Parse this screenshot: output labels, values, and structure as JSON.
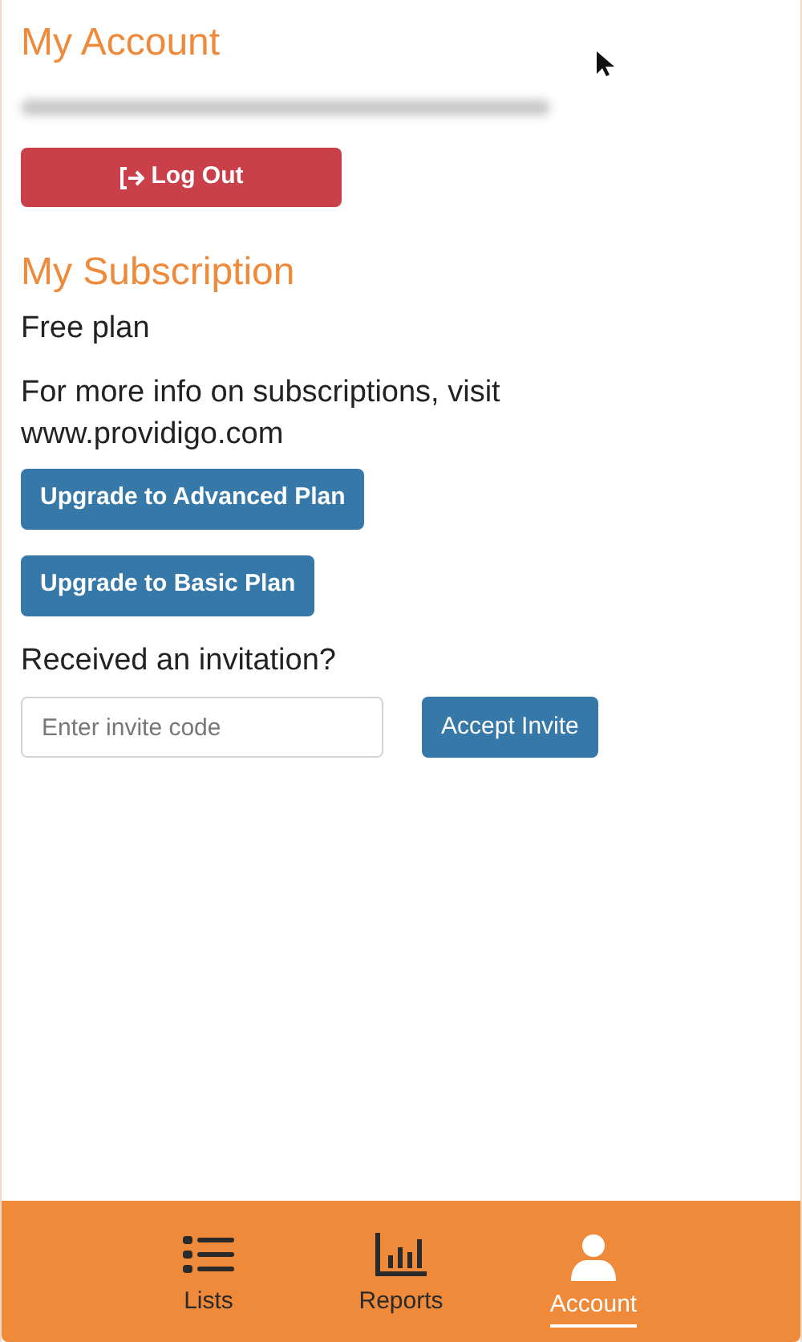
{
  "account": {
    "title": "My Account",
    "logout_button": "Log Out"
  },
  "subscription": {
    "title": "My Subscription",
    "plan": "Free plan",
    "info": "For more info on subscriptions, visit www.providigo.com",
    "buttons": [
      "Upgrade to Advanced Plan",
      "Upgrade to Basic Plan"
    ]
  },
  "invitation": {
    "label": "Received an invitation?",
    "placeholder": "Enter invite code",
    "button": "Accept Invite"
  },
  "tabs": [
    {
      "kind": "list",
      "label": "Lists",
      "selected": false
    },
    {
      "kind": "chart",
      "label": "Reports",
      "selected": false
    },
    {
      "kind": "person",
      "label": "Account",
      "selected": true
    }
  ]
}
